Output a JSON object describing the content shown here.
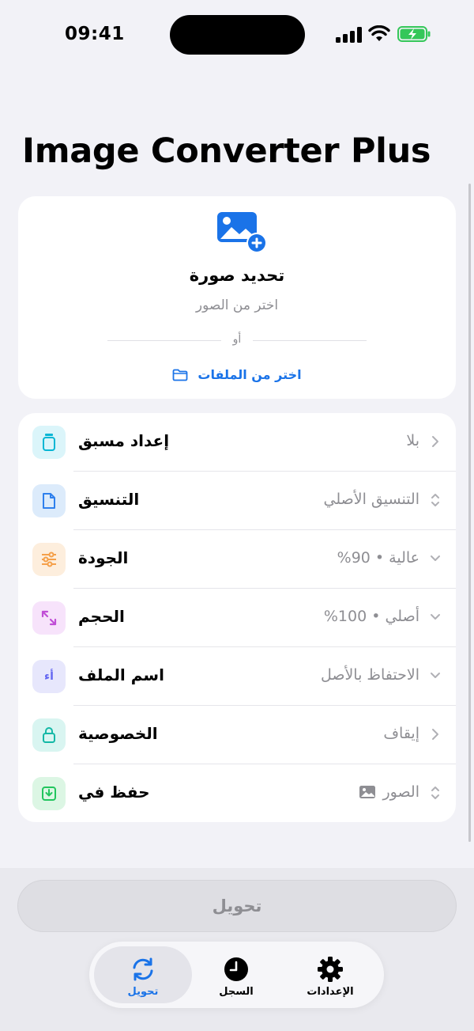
{
  "status_bar": {
    "time": "09:41"
  },
  "app_title": "Image Converter Plus",
  "upload": {
    "title": "تحديد صورة",
    "subtitle": "اختر من الصور",
    "or_label": "أو",
    "files_link": "اختر من الملفات"
  },
  "settings": [
    {
      "label": "إعداد مسبق",
      "value": "بلا",
      "chevron": "chevron-right",
      "icon": "preset-icon",
      "color": "#06b6d4",
      "bg": "#dbf5fa"
    },
    {
      "label": "التنسيق",
      "value": "التنسيق الأصلي",
      "chevron": "chevron-up-down",
      "icon": "document-icon",
      "color": "#2f80ed",
      "bg": "#dcebfb"
    },
    {
      "label": "الجودة",
      "value": "عالية • 90%",
      "chevron": "chevron-down",
      "icon": "sliders-icon",
      "color": "#f5a04a",
      "bg": "#fdeedd"
    },
    {
      "label": "الحجم",
      "value": "أصلي • 100%",
      "chevron": "chevron-down",
      "icon": "resize-icon",
      "color": "#c04fd6",
      "bg": "#f7e3fb"
    },
    {
      "label": "اسم الملف",
      "value": "الاحتفاظ بالأصل",
      "chevron": "chevron-down",
      "icon": "filename-icon",
      "color": "#6366f1",
      "bg": "#e7e7fc",
      "icon_text": "أء"
    },
    {
      "label": "الخصوصية",
      "value": "إيقاف",
      "chevron": "chevron-right",
      "icon": "lock-icon",
      "color": "#14b8a6",
      "bg": "#d9f5f1"
    },
    {
      "label": "حفظ في",
      "value": "الصور",
      "chevron": "chevron-up-down",
      "icon": "download-icon",
      "color": "#22c55e",
      "bg": "#dcf6e4",
      "value_icon": "photo-icon"
    }
  ],
  "convert_button": "تحويل",
  "tabs": [
    {
      "label": "تحويل",
      "icon": "convert-icon",
      "active": true
    },
    {
      "label": "السجل",
      "icon": "clock-icon",
      "active": false
    },
    {
      "label": "الإعدادات",
      "icon": "gear-icon",
      "active": false
    }
  ],
  "colors": {
    "accent": "#1a73e8",
    "background": "#f2f2f7",
    "secondary_text": "#8e8e93"
  }
}
